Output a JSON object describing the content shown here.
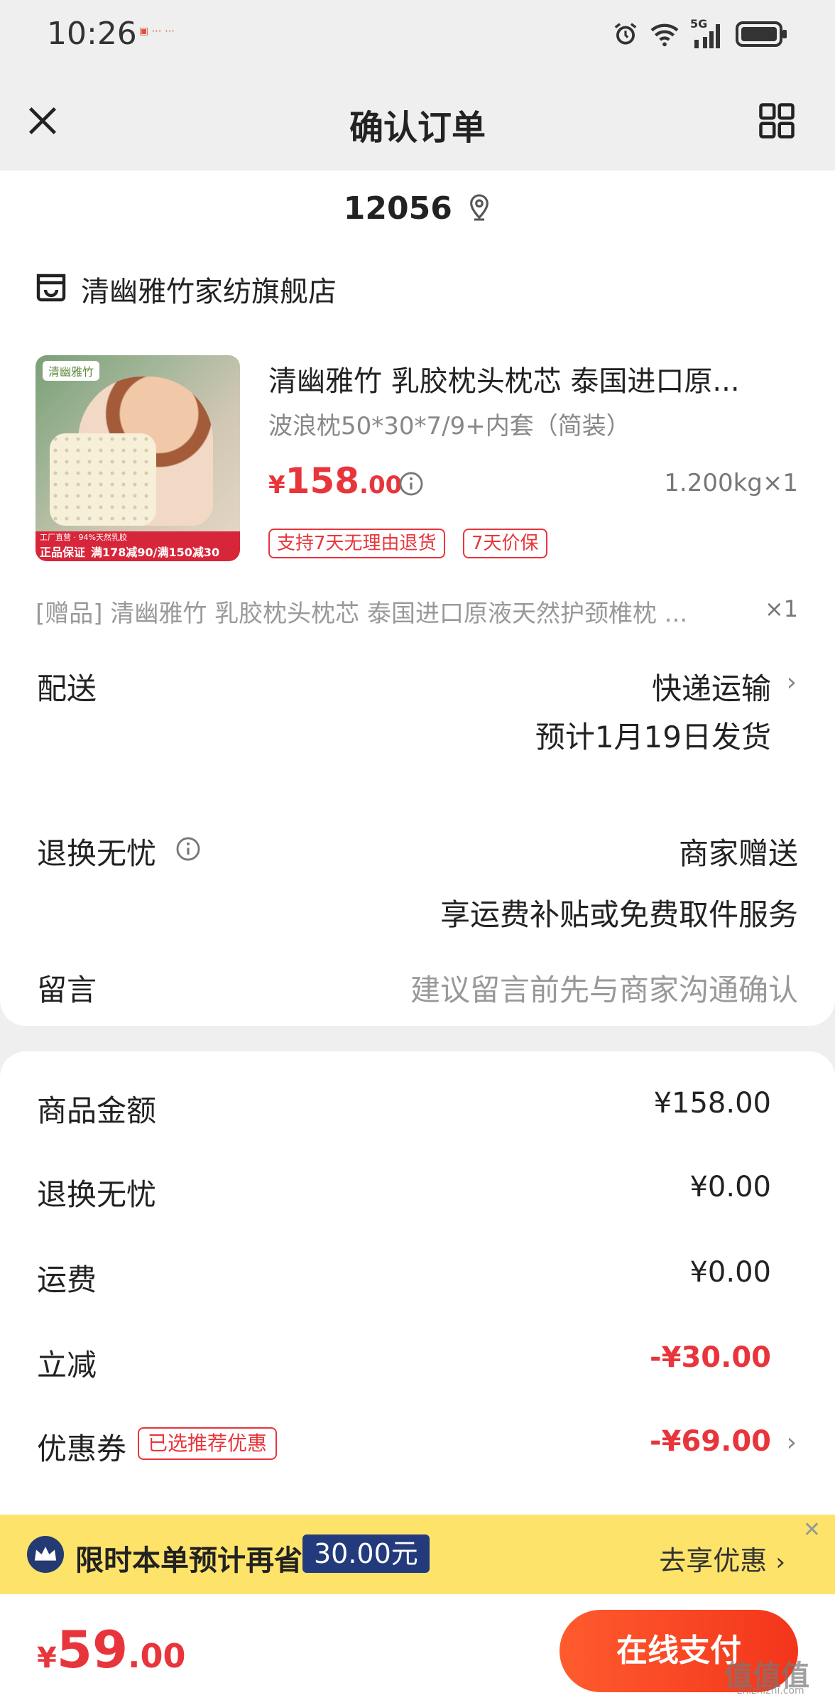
{
  "status": {
    "time": "10:26",
    "network": "5G"
  },
  "nav": {
    "title": "确认订单"
  },
  "address": {
    "text": "12056"
  },
  "store": {
    "name": "清幽雅竹家纺旗舰店"
  },
  "product": {
    "title": "清幽雅竹 乳胶枕头枕芯 泰国进口原...",
    "spec": "波浪枕50*30*7/9+内套（简装）",
    "price_symbol": "¥",
    "price_int": "158",
    "price_dec": ".00",
    "weight_qty": "1.200kg×1",
    "tags": [
      "支持7天无理由退货",
      "7天价保"
    ],
    "thumb": {
      "brand": "清幽雅竹",
      "banner_top": "工厂直营 · 94%天然乳胶",
      "banner_bottom": "正品保证",
      "promo": "满178减90/满150减30"
    }
  },
  "gift": {
    "text": "[赠品] 清幽雅竹 乳胶枕头枕芯 泰国进口原液天然护颈椎枕 ...",
    "qty": "×1"
  },
  "delivery": {
    "label": "配送",
    "method": "快递运输",
    "eta": "预计1月19日发货"
  },
  "returns": {
    "label": "退换无忧",
    "value": "商家赠送",
    "desc": "享运费补贴或免费取件服务"
  },
  "message": {
    "label": "留言",
    "placeholder": "建议留言前先与商家沟通确认"
  },
  "summary": {
    "goods_label": "商品金额",
    "goods_value": "¥158.00",
    "returns_label": "退换无忧",
    "returns_value": "¥0.00",
    "shipping_label": "运费",
    "shipping_value": "¥0.00",
    "discount_label": "立减",
    "discount_value": "-¥30.00",
    "coupon_label": "优惠券",
    "coupon_tag": "已选推荐优惠",
    "coupon_value": "-¥69.00"
  },
  "banner": {
    "text": "限时本单预计再省",
    "amount": "30.00元",
    "link": "去享优惠"
  },
  "footer": {
    "total_symbol": "¥",
    "total_int": "59",
    "total_dec": ".00",
    "pay_label": "在线支付"
  },
  "watermark": {
    "text": "值值值",
    "sub": "zhizhizhi.com"
  },
  "colors": {
    "accent_red": "#e8353b",
    "banner_yellow": "#fde36a",
    "banner_navy": "#233b7c",
    "pay_orange": "#f3351b"
  }
}
